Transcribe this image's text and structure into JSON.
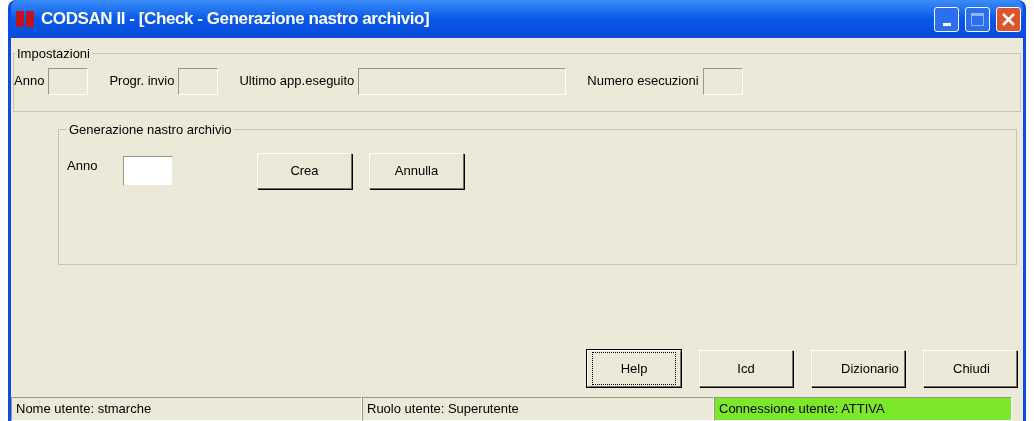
{
  "window": {
    "title": "CODSAN II - [Check - Generazione nastro archivio]"
  },
  "settings": {
    "title": "Impostazioni",
    "fields": [
      {
        "label": "Anno"
      },
      {
        "label": "Progr. invio"
      },
      {
        "label": "Ultimo app.eseguito"
      },
      {
        "label": "Numero esecuzioni"
      }
    ]
  },
  "generation": {
    "title": "Generazione nastro archivio",
    "field": {
      "label": "Anno"
    },
    "buttons": [
      "Crea",
      "Annulla"
    ]
  },
  "buttons": [
    {
      "label": "Help",
      "focused": true
    },
    {
      "label": "Icd",
      "focused": false
    },
    {
      "label": "Dizionario",
      "focused": false
    },
    {
      "label": "Chiudi",
      "focused": false
    }
  ],
  "status_bar": [
    {
      "text": "Nome utente: stmarche",
      "color": "#ece9d8"
    },
    {
      "text": "Ruolo utente: Superutente",
      "color": "#ece9d8"
    },
    {
      "text": "Connessione utente: ATTIVA",
      "color": "#7ce82a"
    }
  ]
}
